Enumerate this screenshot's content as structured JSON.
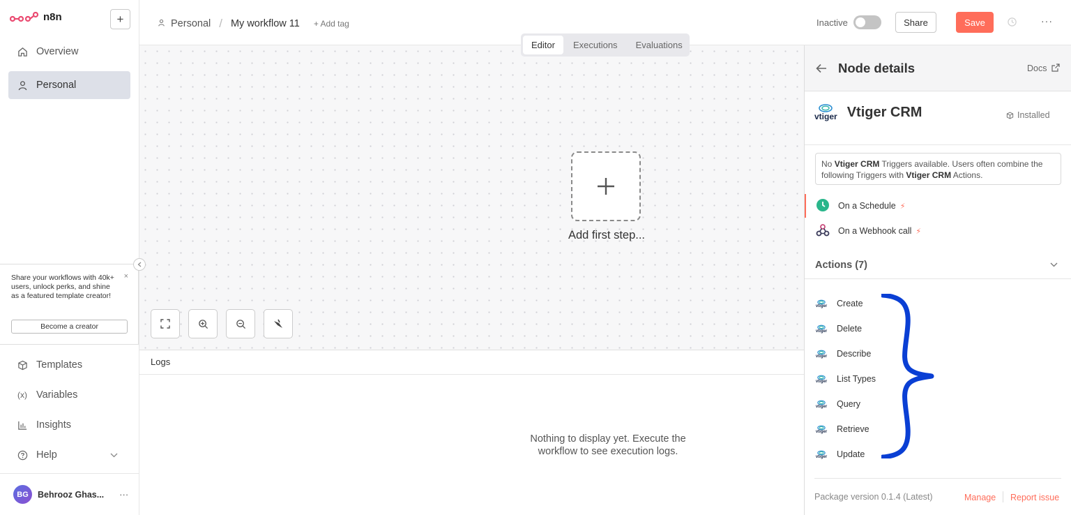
{
  "app": {
    "name": "n8n",
    "new_button": "+"
  },
  "sidebar": {
    "items": [
      {
        "label": "Overview",
        "icon": "home-icon"
      },
      {
        "label": "Personal",
        "icon": "user-icon",
        "active": true
      }
    ],
    "promo": {
      "text": "Share your workflows with 40k+ users, unlock perks, and shine as a featured template creator!",
      "button": "Become a creator",
      "close": "×"
    },
    "bottom": [
      {
        "label": "Templates",
        "icon": "box-icon"
      },
      {
        "label": "Variables",
        "icon": "variables-icon"
      },
      {
        "label": "Insights",
        "icon": "chart-icon"
      },
      {
        "label": "Help",
        "icon": "help-icon"
      }
    ],
    "user": {
      "initials": "BG",
      "name": "Behrooz Ghas...",
      "menu": "···"
    }
  },
  "header": {
    "breadcrumb_project": "Personal",
    "breadcrumb_sep": "/",
    "workflow_name": "My workflow 11",
    "add_tag": "+ Add tag",
    "active_label": "Inactive",
    "share": "Share",
    "save": "Save",
    "more": "···"
  },
  "tabs": [
    {
      "label": "Editor",
      "active": true
    },
    {
      "label": "Executions"
    },
    {
      "label": "Evaluations"
    }
  ],
  "canvas": {
    "add_first_step": "Add first step..."
  },
  "logs": {
    "title": "Logs",
    "empty_line1": "Nothing to display yet. Execute the",
    "empty_line2": "workflow to see execution logs."
  },
  "panel": {
    "title": "Node details",
    "docs": "Docs",
    "node_name": "Vtiger CRM",
    "logo_word": "vtiger",
    "installed": "Installed",
    "info_prefix": "No ",
    "info_node": "Vtiger CRM",
    "info_mid": " Triggers available. Users often combine the following Triggers with ",
    "info_node2": "Vtiger CRM",
    "info_suffix": " Actions.",
    "triggers": [
      {
        "label": "On a Schedule",
        "icon": "clock-icon"
      },
      {
        "label": "On a Webhook call",
        "icon": "webhook-icon"
      }
    ],
    "actions_title": "Actions (7)",
    "actions": [
      "Create",
      "Delete",
      "Describe",
      "List Types",
      "Query",
      "Retrieve",
      "Update"
    ],
    "package_version": "Package version 0.1.4 (Latest)",
    "manage": "Manage",
    "report": "Report issue"
  },
  "colors": {
    "accent": "#ff6d5a",
    "brace": "#0a3fd4",
    "schedule": "#2ab68b"
  }
}
